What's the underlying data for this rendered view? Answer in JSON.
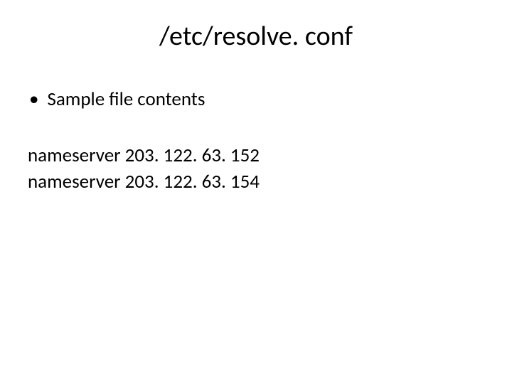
{
  "slide": {
    "title": "/etc/resolve. conf",
    "bullet_marker": "•",
    "bullet_text": "Sample file contents",
    "lines": [
      "nameserver 203. 122. 63. 152",
      "nameserver 203. 122. 63. 154"
    ]
  }
}
